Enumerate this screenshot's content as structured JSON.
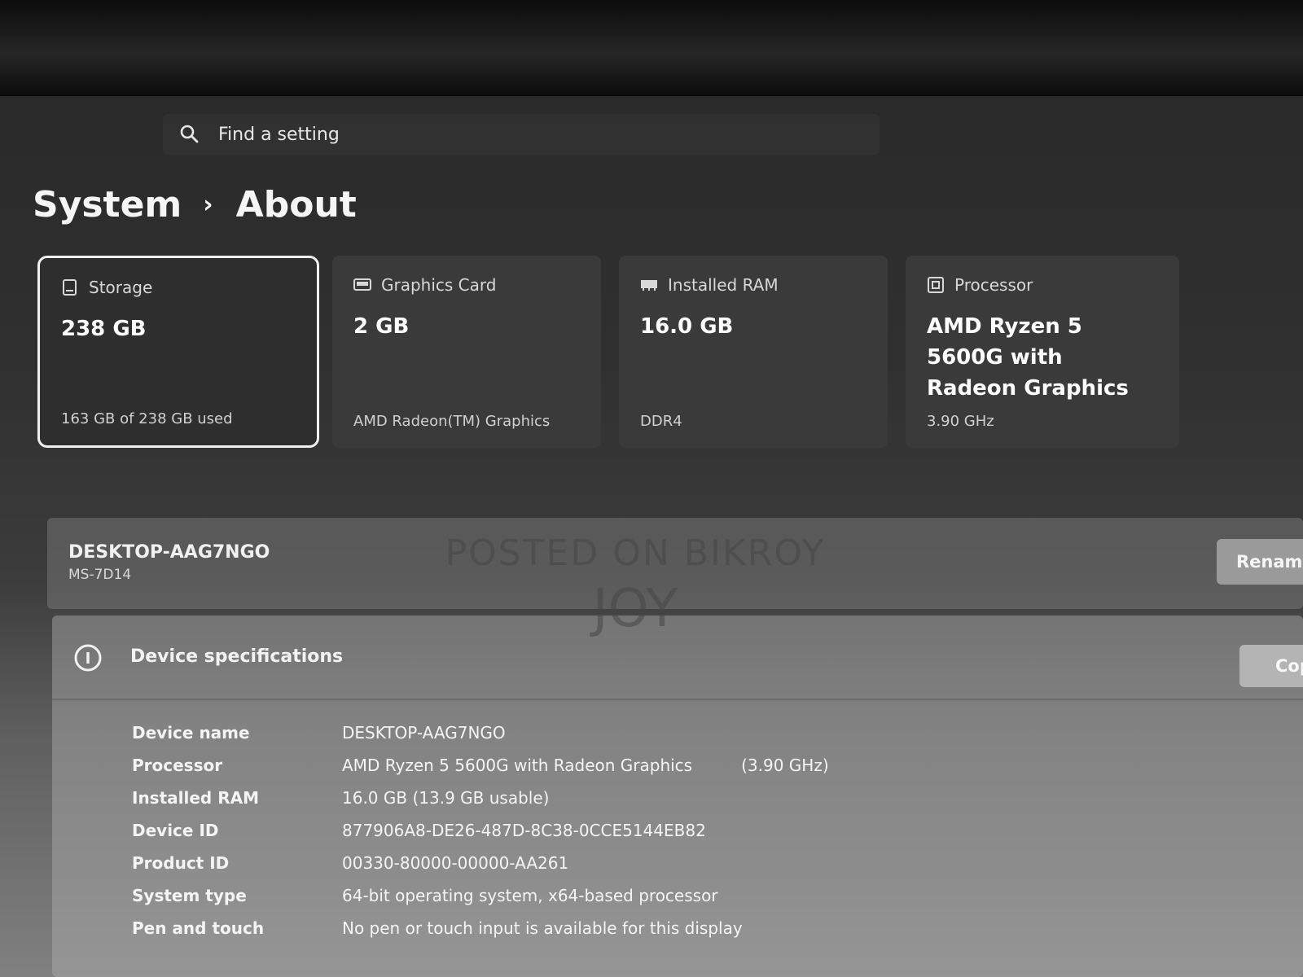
{
  "search": {
    "placeholder": "Find a setting"
  },
  "breadcrumb": {
    "parent": "System",
    "separator": "›",
    "current": "About"
  },
  "cards": [
    {
      "title": "Storage",
      "value": "238 GB",
      "sub": "163 GB of 238 GB used",
      "icon": "storage-icon",
      "selected": true
    },
    {
      "title": "Graphics Card",
      "value": "2 GB",
      "sub": "AMD Radeon(TM) Graphics",
      "icon": "graphics-card-icon"
    },
    {
      "title": "Installed RAM",
      "value": "16.0 GB",
      "sub": "DDR4",
      "icon": "ram-icon"
    },
    {
      "title": "Processor",
      "value": "AMD Ryzen 5 5600G with Radeon Graphics",
      "sub": "3.90 GHz",
      "icon": "processor-icon"
    }
  ],
  "device": {
    "name": "DESKTOP-AAG7NGO",
    "model": "MS-7D14",
    "rename_label": "Rename"
  },
  "specs": {
    "title": "Device specifications",
    "copy_label": "Copy",
    "rows": [
      {
        "label": "Device name",
        "value": "DESKTOP-AAG7NGO"
      },
      {
        "label": "Processor",
        "value": "AMD Ryzen 5 5600G with Radeon Graphics",
        "extra": "(3.90 GHz)"
      },
      {
        "label": "Installed RAM",
        "value": "16.0 GB (13.9 GB usable)"
      },
      {
        "label": "Device ID",
        "value": "877906A8-DE26-487D-8C38-0CCE5144EB82"
      },
      {
        "label": "Product ID",
        "value": "00330-80000-00000-AA261"
      },
      {
        "label": "System type",
        "value": "64-bit operating system, x64-based processor"
      },
      {
        "label": "Pen and touch",
        "value": "No pen or touch input is available for this display"
      }
    ]
  },
  "watermark": {
    "line1": "POSTED ON BIKROY",
    "line2": "JOY"
  },
  "colors": {
    "background": "#2a2a2a",
    "card": "#3a3a3a",
    "selected_border": "#f0f0f0",
    "text": "#f2f2f2"
  }
}
